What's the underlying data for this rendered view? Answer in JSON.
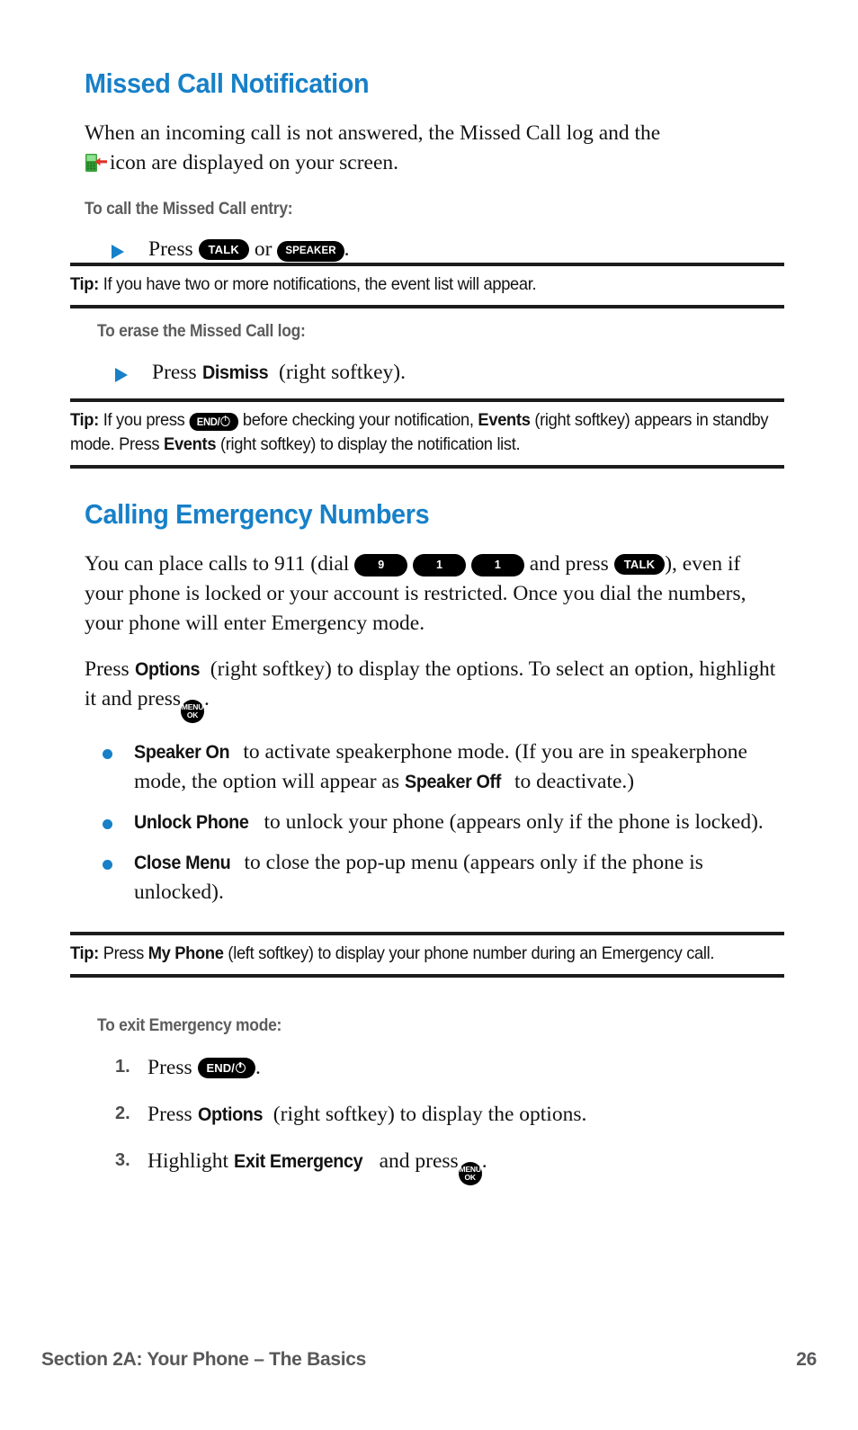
{
  "sections": [
    {
      "heading": "Missed Call Notification",
      "intro_part1": "When an incoming call is not answered, the Missed Call log and the",
      "intro_part2": "icon are displayed on your screen.",
      "subhead_call": "To call the Missed Call entry:",
      "step_press": "Press",
      "key_talk": "TALK",
      "word_or": "or",
      "key_speaker": "SPEAKER",
      "period": ".",
      "tip1_label": "Tip:",
      "tip1_text": "If you have two or more notifications, the event list will appear.",
      "subhead_erase": "To erase the Missed Call log:",
      "erase_press": "Press",
      "erase_bold": "Dismiss",
      "erase_tail": "(right softkey).",
      "tip2_label": "Tip:",
      "tip2_a": "If you press",
      "tip2_key": "END/",
      "tip2_b": "before checking your notification,",
      "tip2_bold1": "Events",
      "tip2_c": "(right softkey) appears in standby mode. Press",
      "tip2_bold2": "Events",
      "tip2_d": "(right softkey) to display the notification list."
    },
    {
      "heading": "Calling Emergency Numbers",
      "p1_a": "You can place calls to 911 (dial",
      "key_9": "9",
      "key_1a": "1",
      "key_1b": "1",
      "p1_b": "and press",
      "key_talk": "TALK",
      "p1_c": "), even if your phone is locked or your account is restricted. Once you dial the numbers, your phone will enter Emergency mode.",
      "p2_a": "Press",
      "p2_bold": "Options",
      "p2_b": "(right softkey) to display the options. To select an option, highlight it and press",
      "key_menu_top": "MENU",
      "key_menu_bottom": "OK",
      "p2_c": ".",
      "bullets": [
        {
          "bold1": "Speaker On",
          "text1": "to activate speakerphone mode. (If you are in speakerphone mode, the option will appear as",
          "bold2": "Speaker Off",
          "text2": "to deactivate.)"
        },
        {
          "bold1": "Unlock Phone",
          "text1": "to unlock your phone (appears only if the phone is locked).",
          "bold2": "",
          "text2": ""
        },
        {
          "bold1": "Close Menu",
          "text1": "to close the pop-up menu (appears only if the phone is unlocked).",
          "bold2": "",
          "text2": ""
        }
      ],
      "tip3_label": "Tip:",
      "tip3_a": "Press",
      "tip3_bold": "My Phone",
      "tip3_b": "(left softkey) to display your phone number during an Emergency call.",
      "subhead_exit": "To exit Emergency mode:",
      "steps": [
        {
          "number": "1.",
          "text_a": "Press",
          "bold": "",
          "text_b": "",
          "key": "END/",
          "tail": "."
        },
        {
          "number": "2.",
          "text_a": "Press",
          "bold": "Options",
          "text_b": "(right softkey) to display the options.",
          "key": "",
          "tail": ""
        },
        {
          "number": "3.",
          "text_a": "Highlight",
          "bold": "Exit Emergency",
          "text_b": "and press",
          "key": "MENU-OK",
          "tail": "."
        }
      ]
    }
  ],
  "footer": {
    "section_label": "Section 2A: Your Phone – The Basics",
    "page_number": "26"
  },
  "colors": {
    "heading_blue": "#1780c8",
    "subhead_gray": "#5c5c5c",
    "body_black": "#131313",
    "rule_black": "#1c1c1c",
    "footer_gray": "#58585a",
    "icon_green": "#49b749",
    "icon_red": "#e23228"
  },
  "icons": {
    "missed_call": "missed-call-icon",
    "bullet_triangle": "triangle-bullet-icon",
    "bullet_dot": "round-bullet-icon"
  }
}
